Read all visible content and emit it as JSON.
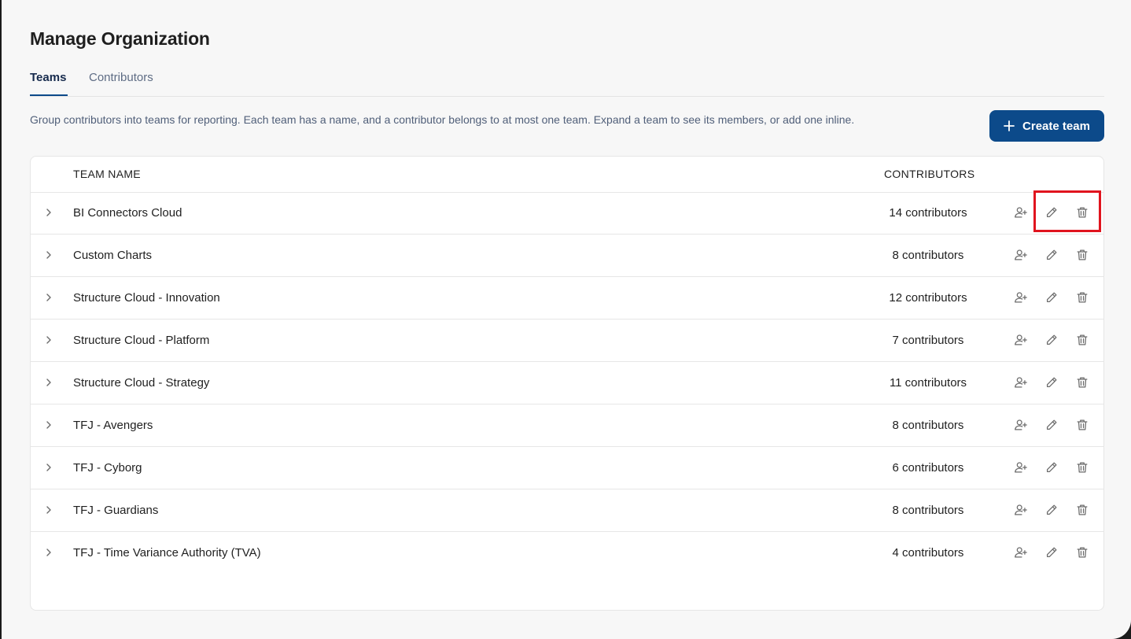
{
  "page": {
    "title": "Manage Organization",
    "description": "Group contributors into teams for reporting. Each team has a name, and a contributor belongs to at most one team. Expand a team to see its members, or add one inline."
  },
  "tabs": [
    {
      "label": "Teams",
      "active": true
    },
    {
      "label": "Contributors",
      "active": false
    }
  ],
  "toolbar": {
    "create_label": "Create team"
  },
  "table": {
    "headers": {
      "name": "TEAM NAME",
      "contributors": "CONTRIBUTORS"
    },
    "rows": [
      {
        "name": "BI Connectors Cloud",
        "contributors": "14 contributors"
      },
      {
        "name": "Custom Charts",
        "contributors": "8 contributors"
      },
      {
        "name": "Structure Cloud - Innovation",
        "contributors": "12 contributors"
      },
      {
        "name": "Structure Cloud - Platform",
        "contributors": "7 contributors"
      },
      {
        "name": "Structure Cloud - Strategy",
        "contributors": "11 contributors"
      },
      {
        "name": "TFJ - Avengers",
        "contributors": "8 contributors"
      },
      {
        "name": "TFJ - Cyborg",
        "contributors": "6 contributors"
      },
      {
        "name": "TFJ - Guardians",
        "contributors": "8 contributors"
      },
      {
        "name": "TFJ - Time Variance Authority (TVA)",
        "contributors": "4 contributors"
      }
    ],
    "row_icons": [
      "chevron-right-icon",
      "add-user-icon",
      "pencil-icon",
      "trash-icon"
    ]
  },
  "colors": {
    "primary": "#0c4a8a",
    "highlight": "#e0141e",
    "icon": "#6b6b6b"
  }
}
